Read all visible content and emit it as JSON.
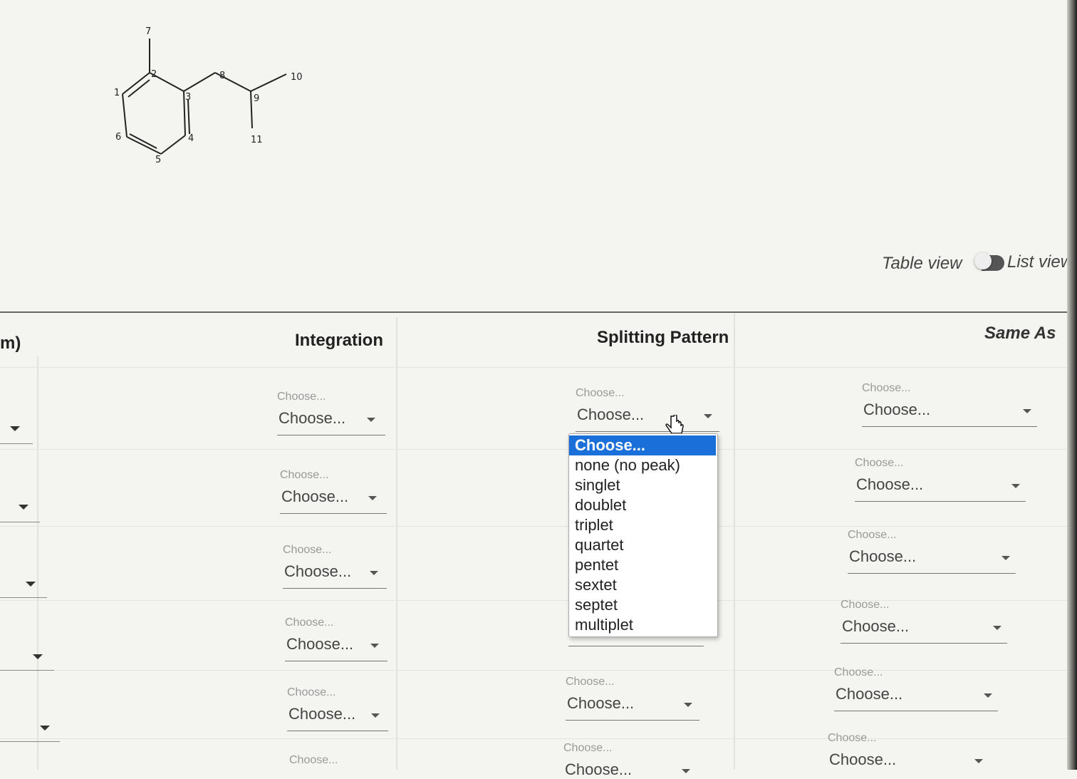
{
  "molecule": {
    "atom_labels": [
      "1",
      "2",
      "3",
      "4",
      "5",
      "6",
      "7",
      "8",
      "9",
      "10",
      "11"
    ]
  },
  "view_toggle": {
    "left_label": "Table view",
    "right_label": "List view"
  },
  "table": {
    "partial_header": "m)",
    "headers": {
      "integration": "Integration",
      "splitting": "Splitting Pattern",
      "same_as": "Same As"
    },
    "select_caption": "Choose...",
    "select_value": "Choose...",
    "row_count": 6
  },
  "dropdown": {
    "options": [
      "Choose...",
      "none (no peak)",
      "singlet",
      "doublet",
      "triplet",
      "quartet",
      "pentet",
      "sextet",
      "septet",
      "multiplet"
    ],
    "selected_index": 0
  },
  "colors": {
    "selected_option": "#1a6fd8",
    "background": "#f4f4f0"
  }
}
